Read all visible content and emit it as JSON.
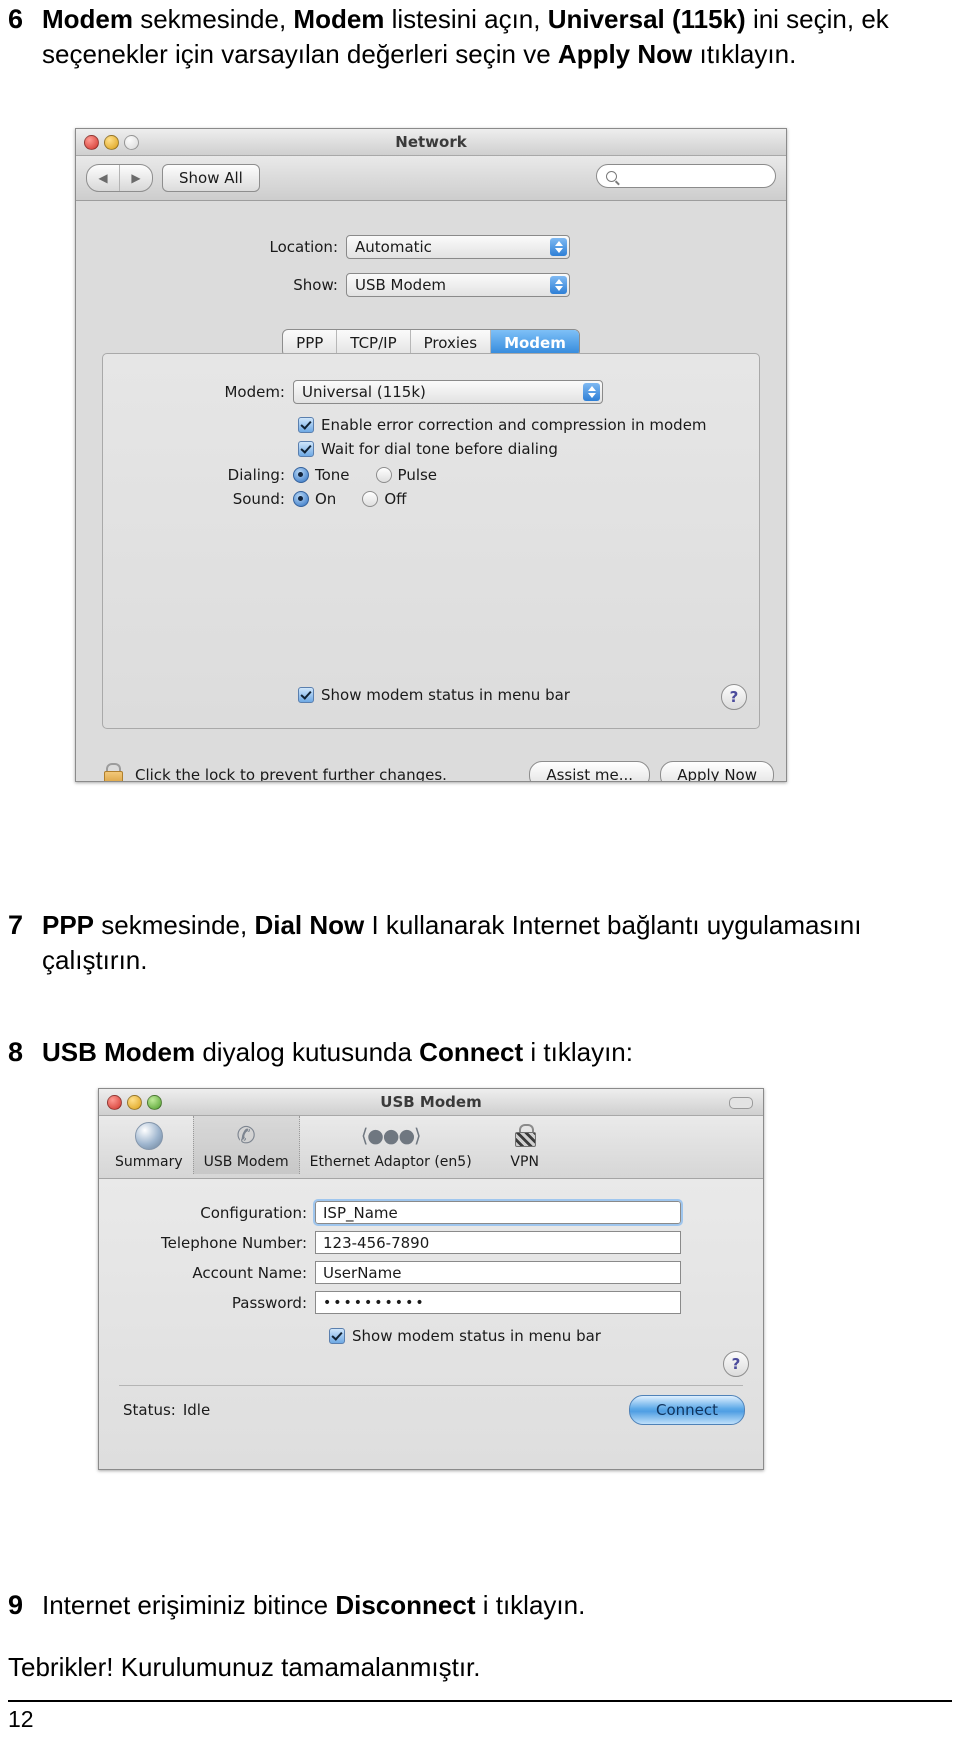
{
  "steps": {
    "six": {
      "number": "6",
      "parts": [
        {
          "t": "Modem",
          "b": true
        },
        {
          "t": " sekmesinde, ",
          "b": false
        },
        {
          "t": "Modem",
          "b": true
        },
        {
          "t": " listesini açın, ",
          "b": false
        },
        {
          "t": "Universal (115k)",
          "b": true
        },
        {
          "t": " ini seçin, ek seçenekler için varsayılan değerleri seçin ve ",
          "b": false
        },
        {
          "t": "Apply Now",
          "b": true
        },
        {
          "t": " ıtıklayın.",
          "b": false
        }
      ]
    },
    "seven": {
      "number": "7",
      "parts": [
        {
          "t": "PPP",
          "b": true
        },
        {
          "t": " sekmesinde, ",
          "b": false
        },
        {
          "t": "Dial Now",
          "b": true
        },
        {
          "t": " I kullanarak Internet bağlantı uygulamasını çalıştırın.",
          "b": false
        }
      ]
    },
    "eight": {
      "number": "8",
      "parts": [
        {
          "t": "USB Modem",
          "b": true
        },
        {
          "t": " diyalog kutusunda ",
          "b": false
        },
        {
          "t": "Connect",
          "b": true
        },
        {
          "t": " i tıklayın:",
          "b": false
        }
      ]
    },
    "nine": {
      "number": "9",
      "parts": [
        {
          "t": "Internet erişiminiz bitince ",
          "b": false
        },
        {
          "t": "Disconnect",
          "b": true
        },
        {
          "t": " i tıklayın.",
          "b": false
        }
      ]
    },
    "closing": "Tebrikler! Kurulumunuz tamamalanmıştır.",
    "page_number": "12"
  },
  "network_window": {
    "title": "Network",
    "toolbar": {
      "back_icon": "◀",
      "forward_icon": "▶",
      "show_all_label": "Show All",
      "search_placeholder": "",
      "search_value": ""
    },
    "location": {
      "label": "Location:",
      "value": "Automatic"
    },
    "show": {
      "label": "Show:",
      "value": "USB Modem"
    },
    "tabs": [
      {
        "label": "PPP",
        "active": false
      },
      {
        "label": "TCP/IP",
        "active": false
      },
      {
        "label": "Proxies",
        "active": false
      },
      {
        "label": "Modem",
        "active": true
      }
    ],
    "modem": {
      "label": "Modem:",
      "value": "Universal (115k)"
    },
    "checkboxes": [
      {
        "label": "Enable error correction and compression in modem",
        "checked": true
      },
      {
        "label": "Wait for dial tone before dialing",
        "checked": true
      }
    ],
    "dialing": {
      "label": "Dialing:",
      "options": [
        {
          "label": "Tone",
          "selected": true
        },
        {
          "label": "Pulse",
          "selected": false
        }
      ]
    },
    "sound": {
      "label": "Sound:",
      "options": [
        {
          "label": "On",
          "selected": true
        },
        {
          "label": "Off",
          "selected": false
        }
      ]
    },
    "status_checkbox": {
      "label": "Show modem status in menu bar",
      "checked": true
    },
    "help_glyph": "?",
    "lock_text": "Click the lock to prevent further changes.",
    "assist_button": "Assist me...",
    "apply_button": "Apply Now",
    "accent_color": "#2f86da"
  },
  "usb_window": {
    "title": "USB Modem",
    "toolbar_items": [
      {
        "label": "Summary",
        "icon": "globe-icon",
        "selected": false
      },
      {
        "label": "USB Modem",
        "icon": "phone-icon",
        "selected": true
      },
      {
        "label": "Ethernet Adaptor (en5)",
        "icon": "ethernet-icon",
        "selected": false
      },
      {
        "label": "VPN",
        "icon": "lock-icon",
        "selected": false
      }
    ],
    "fields": [
      {
        "label": "Configuration:",
        "value": "ISP_Name",
        "type": "combo"
      },
      {
        "label": "Telephone Number:",
        "value": "123-456-7890",
        "type": "text"
      },
      {
        "label": "Account Name:",
        "value": "UserName",
        "type": "text"
      },
      {
        "label": "Password:",
        "value": "••••••••••",
        "type": "password"
      }
    ],
    "status_checkbox": {
      "label": "Show modem status in menu bar",
      "checked": true
    },
    "help_glyph": "?",
    "status": {
      "label": "Status:",
      "value": "Idle"
    },
    "connect_button": "Connect",
    "accent_color": "#4f9ee3"
  }
}
